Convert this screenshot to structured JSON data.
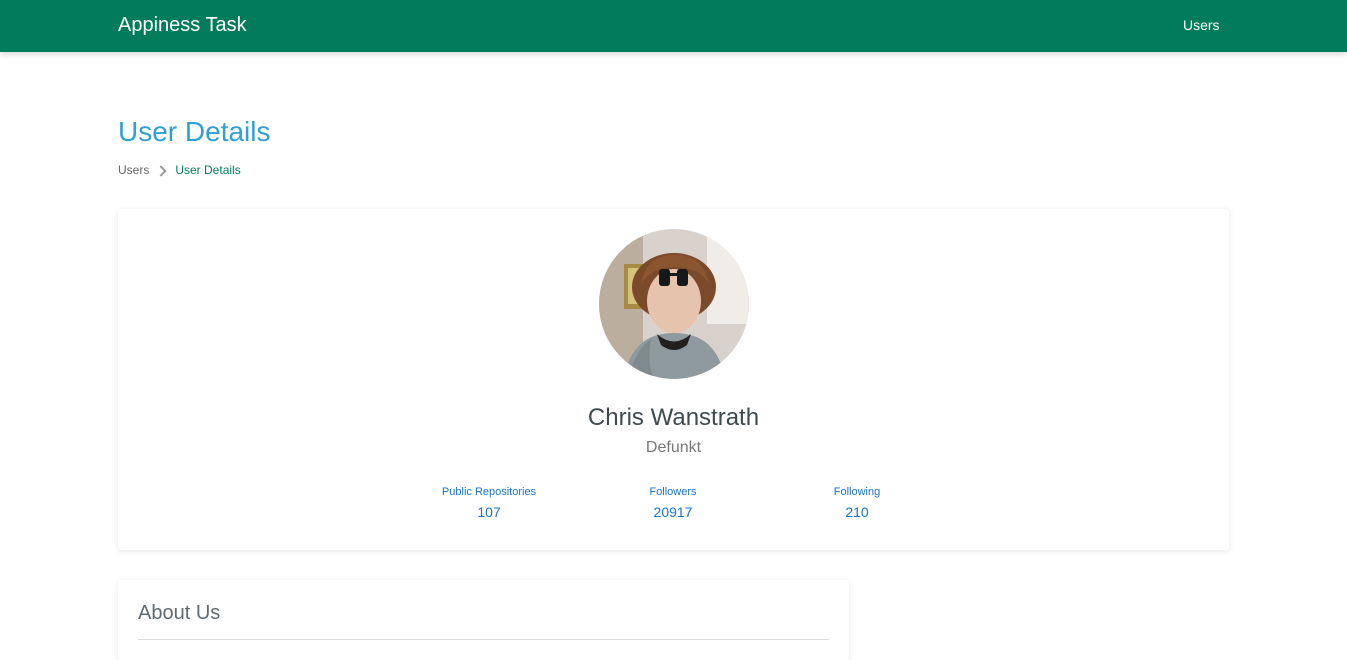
{
  "navbar": {
    "brand": "Appiness Task",
    "links": [
      {
        "label": "Users"
      }
    ]
  },
  "page": {
    "title": "User Details"
  },
  "breadcrumb": {
    "items": [
      {
        "label": "Users"
      },
      {
        "label": "User Details"
      }
    ]
  },
  "profile": {
    "name": "Chris Wanstrath",
    "login": "Defunkt",
    "stats": [
      {
        "label": "Public Repositories",
        "value": "107"
      },
      {
        "label": "Followers",
        "value": "20917"
      },
      {
        "label": "Following",
        "value": "210"
      }
    ]
  },
  "about": {
    "title": "About Us"
  },
  "colors": {
    "navbar": "#007c5c",
    "title": "#2f9fd4",
    "link": "#1a73c9"
  },
  "icons": {
    "breadcrumb_separator": "chevron-right-icon"
  }
}
